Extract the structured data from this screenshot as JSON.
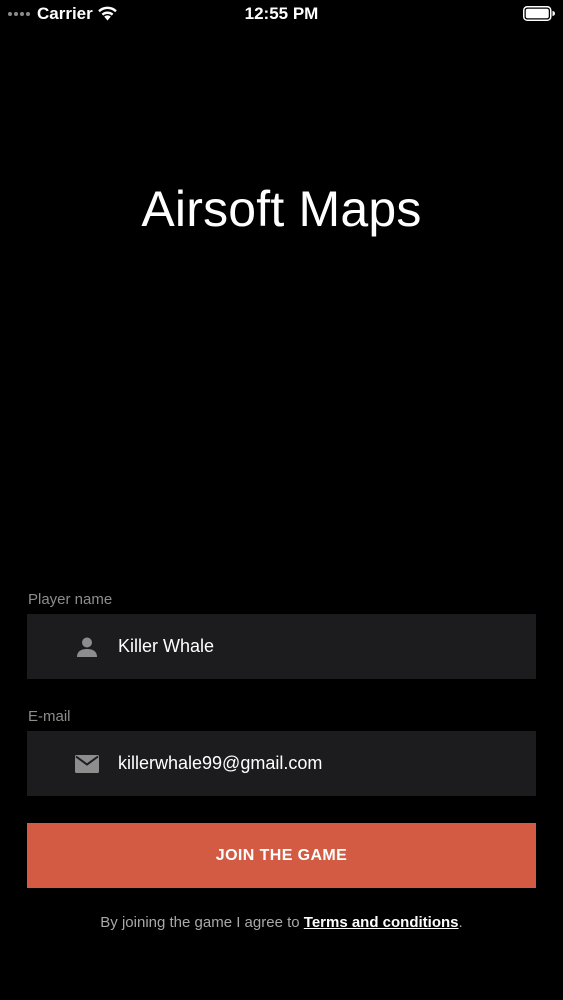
{
  "status_bar": {
    "carrier": "Carrier",
    "time": "12:55 PM",
    "icons": [
      "signal-dots-icon",
      "wifi-icon",
      "battery-icon"
    ]
  },
  "app": {
    "title": "Airsoft Maps"
  },
  "form": {
    "player_name": {
      "label": "Player name",
      "value": "Killer Whale",
      "icon": "person-icon"
    },
    "email": {
      "label": "E-mail",
      "value": "killerwhale99@gmail.com",
      "icon": "mail-icon"
    },
    "join_button_label": "JOIN THE GAME"
  },
  "footer": {
    "prefix": "By joining the game I agree to ",
    "terms_link": "Terms and conditions",
    "suffix": "."
  },
  "colors": {
    "background": "#000000",
    "field_background": "#1c1c1e",
    "accent": "#d35b43",
    "label_gray": "#8d8d8d"
  }
}
